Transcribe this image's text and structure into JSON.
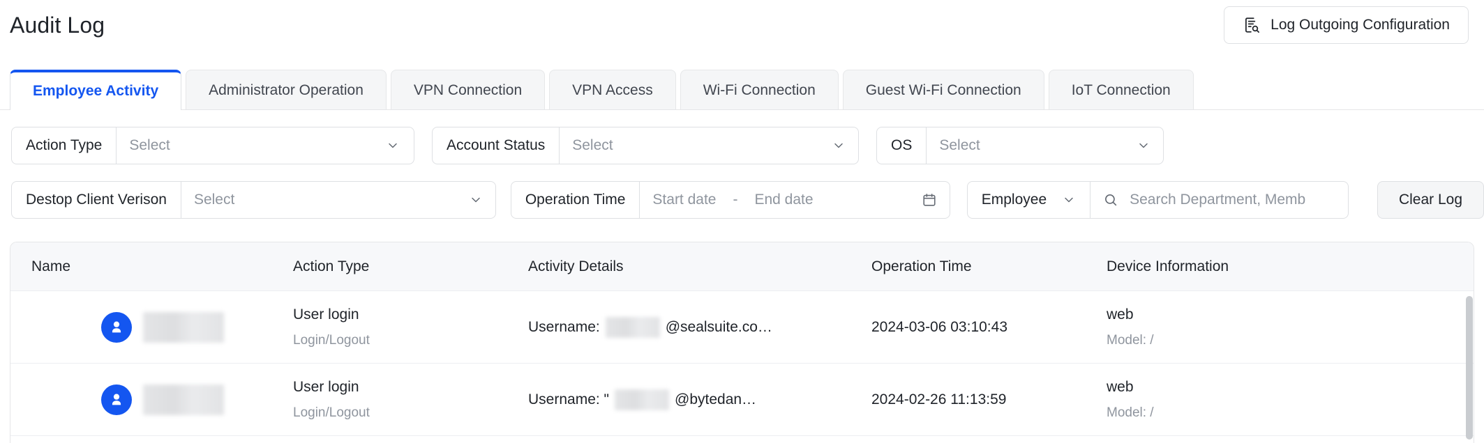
{
  "header": {
    "title": "Audit Log",
    "outgoing_button": {
      "label": "Log Outgoing Configuration",
      "icon": "log-search-icon"
    }
  },
  "tabs": [
    {
      "label": "Employee Activity",
      "active": true
    },
    {
      "label": "Administrator Operation",
      "active": false
    },
    {
      "label": "VPN Connection",
      "active": false
    },
    {
      "label": "VPN Access",
      "active": false
    },
    {
      "label": "Wi-Fi Connection",
      "active": false
    },
    {
      "label": "Guest Wi-Fi Connection",
      "active": false
    },
    {
      "label": "IoT Connection",
      "active": false
    }
  ],
  "filters": {
    "action_type": {
      "label": "Action Type",
      "placeholder": "Select",
      "icon": "chevron-down-icon"
    },
    "account_status": {
      "label": "Account Status",
      "placeholder": "Select",
      "icon": "chevron-down-icon"
    },
    "os": {
      "label": "OS",
      "placeholder": "Select",
      "icon": "chevron-down-icon"
    },
    "desktop_client_version": {
      "label": "Destop Client Verison",
      "placeholder": "Select",
      "icon": "chevron-down-icon"
    },
    "operation_time": {
      "label": "Operation Time",
      "start_placeholder": "Start date",
      "separator": "-",
      "end_placeholder": "End date",
      "icon": "calendar-icon"
    },
    "employee_search": {
      "selected": "Employee",
      "placeholder": "Search Department, Memb",
      "dropdown_icon": "chevron-down-icon",
      "search_icon": "search-icon"
    },
    "clear_log_button": "Clear Log"
  },
  "table": {
    "columns": [
      "Name",
      "Action Type",
      "Activity Details",
      "Operation Time",
      "Device Information"
    ],
    "rows": [
      {
        "name": "",
        "avatar_icon": "user-avatar-icon",
        "action_type": "User login",
        "action_sub": "Login/Logout",
        "details_prefix": "Username:",
        "details_suffix": "@sealsuite.co…",
        "operation_time": "2024-03-06 03:10:43",
        "device": "web",
        "device_model": "Model: /"
      },
      {
        "name": "",
        "avatar_icon": "user-avatar-icon",
        "action_type": "User login",
        "action_sub": "Login/Logout",
        "details_prefix": "Username: \"",
        "details_suffix": "@bytedan…",
        "operation_time": "2024-02-26 11:13:59",
        "device": "web",
        "device_model": "Model: /"
      }
    ]
  },
  "colors": {
    "accent": "#1456f0",
    "text_primary": "#1f2329",
    "text_secondary": "#8f959e",
    "border": "#dee0e3",
    "tab_inactive_bg": "#f5f6f7",
    "table_header_bg": "#f7f8fa"
  }
}
